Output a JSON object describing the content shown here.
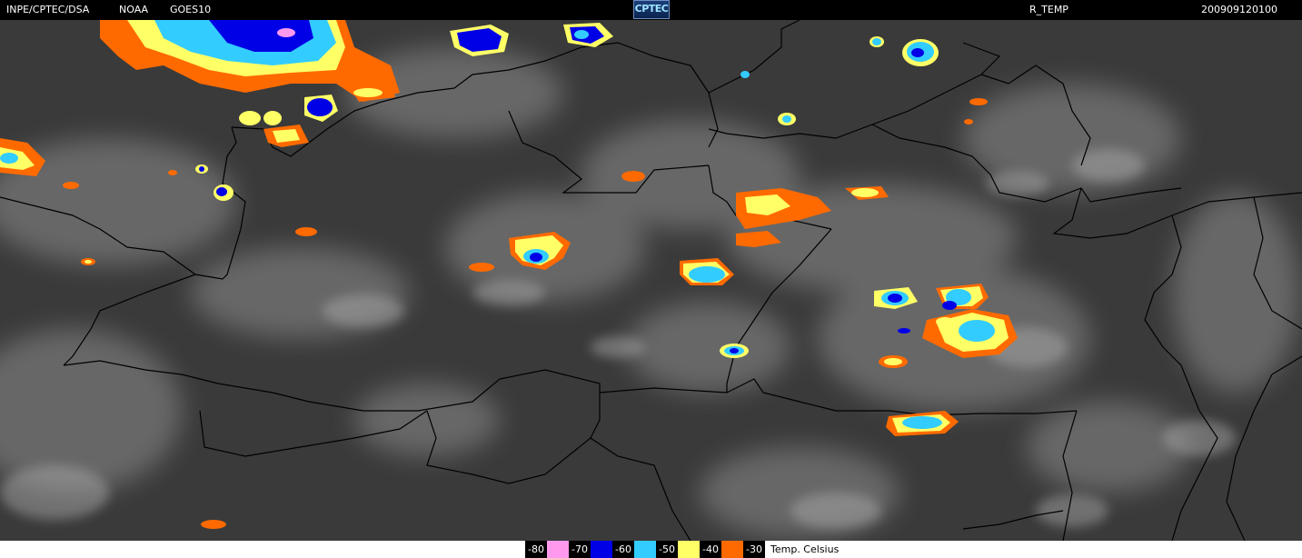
{
  "header": {
    "org": "INPE/CPTEC/DSA",
    "agency": "NOAA",
    "satellite": "GOES10",
    "logo_text": "CPTEC",
    "product": "R_TEMP",
    "timestamp": "200909120100"
  },
  "legend": {
    "entries": [
      {
        "label": "-80",
        "color": "#ff99ee"
      },
      {
        "label": "-70",
        "color": "#0000e6"
      },
      {
        "label": "-60",
        "color": "#33ccff"
      },
      {
        "label": "-50",
        "color": "#ffff66"
      },
      {
        "label": "-40",
        "color": "#ff6a00"
      },
      {
        "label": "-30",
        "color": "#3a3a3a"
      }
    ],
    "unit": "Temp. Celsius"
  }
}
